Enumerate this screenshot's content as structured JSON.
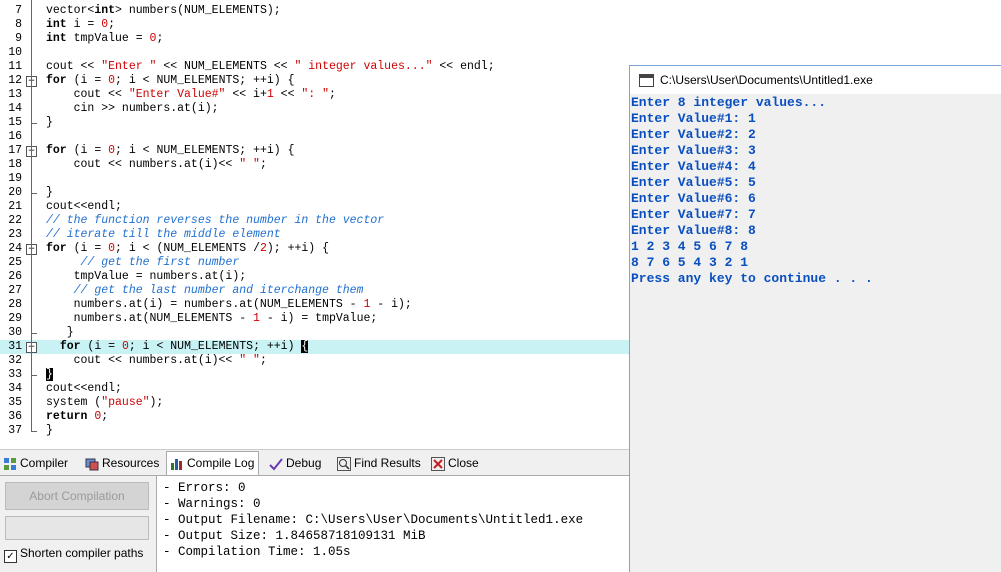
{
  "editor": {
    "lines": [
      {
        "n": "7",
        "html": "vector<int> numbers(NUM_ELEMENTS);"
      },
      {
        "n": "8",
        "html": "int i = 0;"
      },
      {
        "n": "9",
        "html": "int tmpValue = 0;"
      },
      {
        "n": "10",
        "html": ""
      },
      {
        "n": "11",
        "html": "cout << \"Enter \" << NUM_ELEMENTS << \" integer values...\" << endl;"
      },
      {
        "n": "12",
        "html": "for (i = 0; i < NUM_ELEMENTS; ++i) {"
      },
      {
        "n": "13",
        "html": "    cout << \"Enter Value#\" << i+1 << \": \";"
      },
      {
        "n": "14",
        "html": "    cin >> numbers.at(i);"
      },
      {
        "n": "15",
        "html": "}"
      },
      {
        "n": "16",
        "html": ""
      },
      {
        "n": "17",
        "html": "for (i = 0; i < NUM_ELEMENTS; ++i) {"
      },
      {
        "n": "18",
        "html": "    cout << numbers.at(i)<< \" \";"
      },
      {
        "n": "19",
        "html": ""
      },
      {
        "n": "20",
        "html": "}"
      },
      {
        "n": "21",
        "html": "cout<<endl;"
      },
      {
        "n": "22",
        "html": "// the function reverses the number in the vector"
      },
      {
        "n": "23",
        "html": "// iterate till the middle element"
      },
      {
        "n": "24",
        "html": "for (i = 0; i < (NUM_ELEMENTS /2); ++i) {"
      },
      {
        "n": "25",
        "html": "     // get the first number"
      },
      {
        "n": "26",
        "html": "    tmpValue = numbers.at(i);"
      },
      {
        "n": "27",
        "html": "    // get the last number and iterchange them"
      },
      {
        "n": "28",
        "html": "    numbers.at(i) = numbers.at(NUM_ELEMENTS - 1 - i);"
      },
      {
        "n": "29",
        "html": "    numbers.at(NUM_ELEMENTS - 1 - i) = tmpValue;"
      },
      {
        "n": "30",
        "html": "   }"
      },
      {
        "n": "31",
        "html": "  for (i = 0; i < NUM_ELEMENTS; ++i) {"
      },
      {
        "n": "32",
        "html": "    cout << numbers.at(i)<< \" \";"
      },
      {
        "n": "33",
        "html": "}"
      },
      {
        "n": "34",
        "html": "cout<<endl;"
      },
      {
        "n": "35",
        "html": "system (\"pause\");"
      },
      {
        "n": "36",
        "html": "return 0;"
      },
      {
        "n": "37",
        "html": "}"
      }
    ]
  },
  "tabs": [
    {
      "label": "Compiler",
      "icon": "compiler-grid-icon"
    },
    {
      "label": "Resources",
      "icon": "resources-icon"
    },
    {
      "label": "Compile Log",
      "icon": "bar-chart-icon",
      "selected": true
    },
    {
      "label": "Debug",
      "icon": "debug-check-icon"
    },
    {
      "label": "Find Results",
      "icon": "find-magnifier-icon"
    },
    {
      "label": "Close",
      "icon": "close-icon"
    }
  ],
  "bottom": {
    "abort_label": "Abort Compilation",
    "shorten_label": "Shorten compiler paths",
    "shorten_checked": true,
    "log": [
      "- Errors: 0",
      "- Warnings: 0",
      "- Output Filename: C:\\Users\\User\\Documents\\Untitled1.exe",
      "- Output Size: 1.84658718109131 MiB",
      "- Compilation Time: 1.05s"
    ]
  },
  "console": {
    "title": "C:\\Users\\User\\Documents\\Untitled1.exe",
    "lines": [
      "Enter 8 integer values...",
      "Enter Value#1: 1",
      "Enter Value#2: 2",
      "Enter Value#3: 3",
      "Enter Value#4: 4",
      "Enter Value#5: 5",
      "Enter Value#6: 6",
      "Enter Value#7: 7",
      "Enter Value#8: 8",
      "1 2 3 4 5 6 7 8",
      "8 7 6 5 4 3 2 1",
      "Press any key to continue . . ."
    ]
  }
}
